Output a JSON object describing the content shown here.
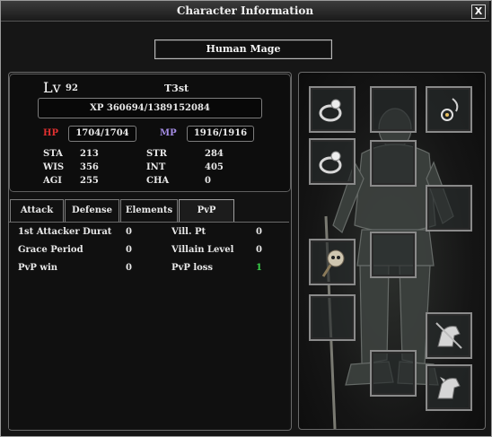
{
  "window": {
    "title": "Character Information",
    "close_label": "X"
  },
  "character": {
    "class_name": "Human Mage",
    "level_label": "Lv",
    "level": "92",
    "name": "T3st",
    "xp_text": "XP  360694/1389152084",
    "hp_label": "HP",
    "hp": "1704/1704",
    "mp_label": "MP",
    "mp": "1916/1916"
  },
  "stats": [
    {
      "label": "STA",
      "value": "213"
    },
    {
      "label": "STR",
      "value": "284"
    },
    {
      "label": "WIS",
      "value": "356"
    },
    {
      "label": "INT",
      "value": "405"
    },
    {
      "label": "AGI",
      "value": "255"
    },
    {
      "label": "CHA",
      "value": "0"
    }
  ],
  "tabs": [
    {
      "label": "Attack"
    },
    {
      "label": "Defense"
    },
    {
      "label": "Elements"
    },
    {
      "label": "PvP",
      "active": true
    }
  ],
  "pvp": [
    {
      "label": "1st  Attacker  Durat",
      "value": "0"
    },
    {
      "label": "Vill.  Pt",
      "value": "0"
    },
    {
      "label": "Grace  Period",
      "value": "0"
    },
    {
      "label": "Villain  Level",
      "value": "0"
    },
    {
      "label": "PvP  win",
      "value": "0"
    },
    {
      "label": "PvP  loss",
      "value": "1",
      "color": "#3ad14a"
    }
  ],
  "equipment_slots": [
    {
      "name": "ring-slot-1",
      "icon": "ring-icon"
    },
    {
      "name": "empty-slot-top-middle",
      "icon": ""
    },
    {
      "name": "earring-slot",
      "icon": "earring-icon"
    },
    {
      "name": "ring-slot-2",
      "icon": "ring-icon"
    },
    {
      "name": "empty-slot-body",
      "icon": ""
    },
    {
      "name": "empty-slot-right-upper",
      "icon": ""
    },
    {
      "name": "staff-slot",
      "icon": "skull-staff-icon"
    },
    {
      "name": "empty-slot-legs",
      "icon": ""
    },
    {
      "name": "empty-slot-left-lower",
      "icon": ""
    },
    {
      "name": "mount-slot-1",
      "icon": "horse-icon"
    },
    {
      "name": "empty-slot-feet",
      "icon": ""
    },
    {
      "name": "mount-slot-2",
      "icon": "horse-icon"
    }
  ]
}
